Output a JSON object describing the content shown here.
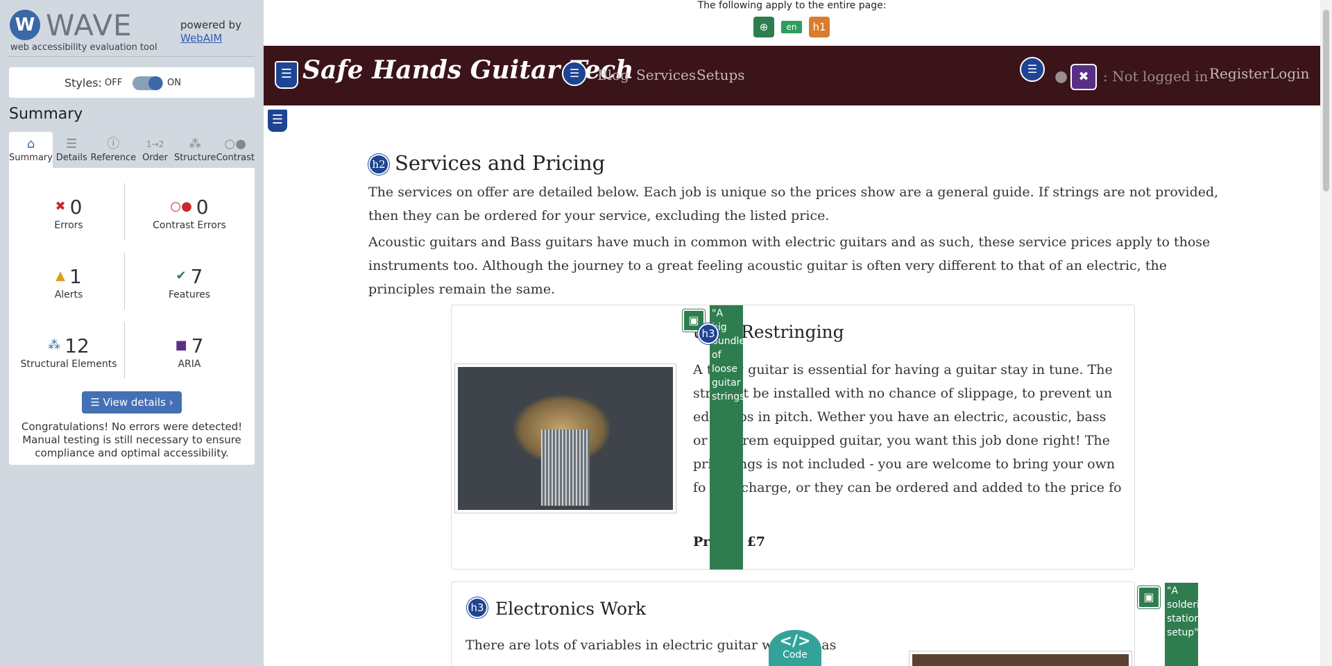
{
  "wave": {
    "logo_letter": "W",
    "logo_text": "WAVE",
    "tagline": "web accessibility evaluation tool",
    "powered_by": "powered by",
    "powered_link": "WebAIM",
    "styles_label": "Styles:",
    "styles_off": "OFF",
    "styles_on": "ON",
    "summary_title": "Summary",
    "tabs": [
      {
        "label": "Summary",
        "icon": "home-icon"
      },
      {
        "label": "Details",
        "icon": "list-icon"
      },
      {
        "label": "Reference",
        "icon": "info-icon"
      },
      {
        "label": "Order",
        "icon": "order-icon"
      },
      {
        "label": "Structure",
        "icon": "structure-icon"
      },
      {
        "label": "Contrast",
        "icon": "contrast-icon"
      }
    ],
    "stats": {
      "errors": {
        "value": "0",
        "label": "Errors"
      },
      "contrast_errors": {
        "value": "0",
        "label": "Contrast Errors"
      },
      "alerts": {
        "value": "1",
        "label": "Alerts"
      },
      "features": {
        "value": "7",
        "label": "Features"
      },
      "structural": {
        "value": "12",
        "label": "Structural Elements"
      },
      "aria": {
        "value": "7",
        "label": "ARIA"
      }
    },
    "view_details": "View details ›",
    "congrats": "Congratulations! No errors were detected! Manual testing is still necessary to ensure compliance and optimal accessibility."
  },
  "page": {
    "apply_text": "The following apply to the entire page:",
    "lang_badge": "en",
    "h1_badge": "h1",
    "brand": "Safe Hands Guitar Tech",
    "nav": [
      "Blog",
      "Services",
      "Setups"
    ],
    "not_logged_in": ": Not logged in",
    "register": "Register",
    "login": "Login",
    "h2_badge": "h2",
    "h3_badge": "h3",
    "heading": "Services and Pricing",
    "para1": "The services on offer are detailed below. Each job is unique so the prices show are a general guide. If strings are not provided, then they can be ordered for your service, excluding the listed price.",
    "para2": "Acoustic guitars and Bass guitars have much in common with electric guitars and as such, these service prices apply to those instruments too. Although the journey to a great feeling acoustic guitar is often very different to that of an electric, the principles remain the same.",
    "card1": {
      "title": "uitar Restringing",
      "text": "A      trung guitar is essential for having a guitar stay in tune. The str      must be installed with no chance of slippage, to prevent un      ed jumps in pitch. Wether you have an electric, acoustic, bass or      ing-trem equipped guitar, you want this job done right! The pri      strings is not included - you are welcome to bring your own fo      xtra charge, or they can be ordered and added to the price fo",
      "price": "Pri      om £7",
      "alt": "\"A big bundle of loose guitar strings\""
    },
    "card2": {
      "title": "Electronics Work",
      "text": "There are lots of variables in electric guitar wirin      nd as",
      "alt": "\"A soldering station setup\""
    },
    "code_label": "Code",
    "code_symbol": "</>"
  }
}
